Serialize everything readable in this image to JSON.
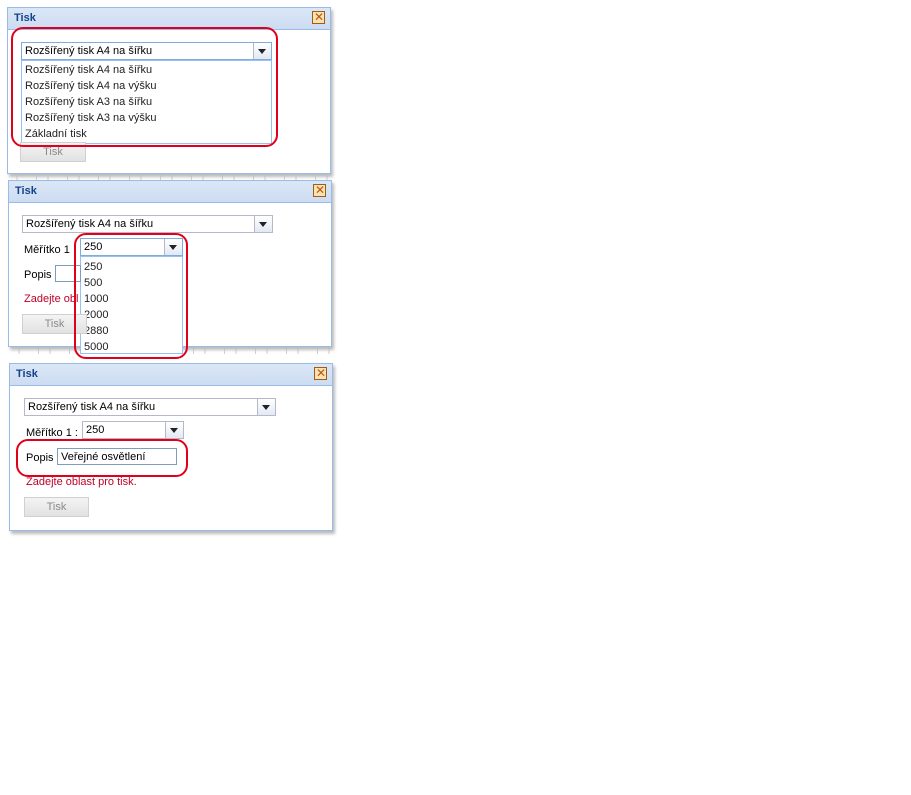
{
  "dialog1": {
    "title": "Tisk",
    "combo_value": "Rozšířený tisk A4 na šířku",
    "options": [
      "Rozšířený tisk A4 na šířku",
      "Rozšířený tisk A4 na výšku",
      "Rozšířený tisk A3 na šířku",
      "Rozšířený tisk A3 na výšku",
      "Základní tisk"
    ],
    "print_button": "Tisk"
  },
  "dialog2": {
    "title": "Tisk",
    "combo_value": "Rozšířený tisk A4 na šířku",
    "scale_label": "Měřítko 1",
    "scale_value": "250",
    "scale_options": [
      "250",
      "500",
      "1000",
      "2000",
      "2880",
      "5000"
    ],
    "desc_label": "Popis",
    "error_text": "Zadejte obl",
    "print_button": "Tisk"
  },
  "dialog3": {
    "title": "Tisk",
    "combo_value": "Rozšířený tisk A4 na šířku",
    "scale_label": "Měřítko 1 :",
    "scale_value": "250",
    "desc_label": "Popis",
    "desc_value": "Veřejné osvětlení",
    "error_text": "Zadejte oblast pro tisk.",
    "print_button": "Tisk"
  },
  "colors": {
    "highlight": "#e0001b",
    "error": "#c0002a",
    "title": "#15428b"
  }
}
